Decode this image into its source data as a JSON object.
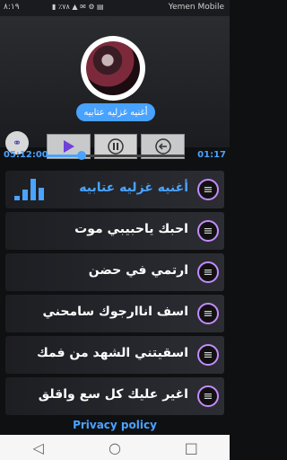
{
  "status": {
    "time": "٨:١٩",
    "battery": "٪٧٨",
    "carrier": "Yemen Mobile"
  },
  "now_playing": {
    "title": "أغنيه غزليه عتابيه",
    "elapsed": "01:17",
    "total": "05:12:00",
    "progress": 0.25
  },
  "songs": [
    {
      "title": "أغنيه غزليه عتابيه",
      "active": true
    },
    {
      "title": "احبك ياحبيبي موت",
      "active": false
    },
    {
      "title": "ارتمي في حضن",
      "active": false
    },
    {
      "title": "اسف اناارجوك سامحني",
      "active": false
    },
    {
      "title": "اسقيتني الشهد من فمك",
      "active": false
    },
    {
      "title": "اغير عليك كل سع واقلق",
      "active": false
    }
  ],
  "footer": {
    "privacy": "Privacy policy"
  },
  "colors": {
    "accent": "#4aa3ff",
    "ring": "#c48bff"
  }
}
